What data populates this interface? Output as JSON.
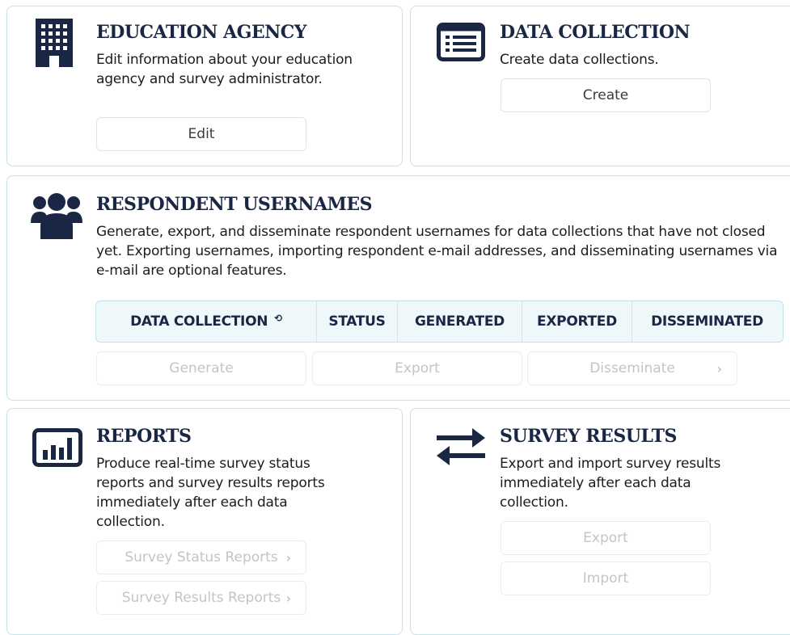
{
  "colors": {
    "accent_navy": "#1a2744",
    "border": "#c3e3ea",
    "table_header_bg": "#eef7fa"
  },
  "education_agency": {
    "icon": "building-icon",
    "title": "EDUCATION AGENCY",
    "description": "Edit information about your education agency and survey administrator.",
    "button": "Edit"
  },
  "data_collection": {
    "icon": "list-icon",
    "title": "DATA COLLECTION",
    "description": "Create data collections.",
    "button": "Create"
  },
  "respondent_usernames": {
    "icon": "users-icon",
    "title": "RESPONDENT USERNAMES",
    "description": "Generate, export, and disseminate respondent usernames for data collections that have not closed yet. Exporting usernames, importing respondent e-mail addresses, and disseminating usernames via e-mail are optional features.",
    "table_headers": [
      "DATA COLLECTION",
      "STATUS",
      "GENERATED",
      "EXPORTED",
      "DISSEMINATED"
    ],
    "sort_icon": "refresh-sort-icon",
    "buttons": {
      "generate": "Generate",
      "export": "Export",
      "disseminate": "Disseminate"
    }
  },
  "reports": {
    "icon": "bar-chart-icon",
    "title": "REPORTS",
    "description": "Produce real-time survey status reports and survey results reports immediately after each data collection.",
    "buttons": {
      "status": "Survey Status Reports",
      "results": "Survey Results Reports"
    }
  },
  "survey_results": {
    "icon": "transfer-arrows-icon",
    "title": "SURVEY RESULTS",
    "description": "Export and import survey results immediately after each data collection.",
    "buttons": {
      "export": "Export",
      "import": "Import"
    }
  }
}
